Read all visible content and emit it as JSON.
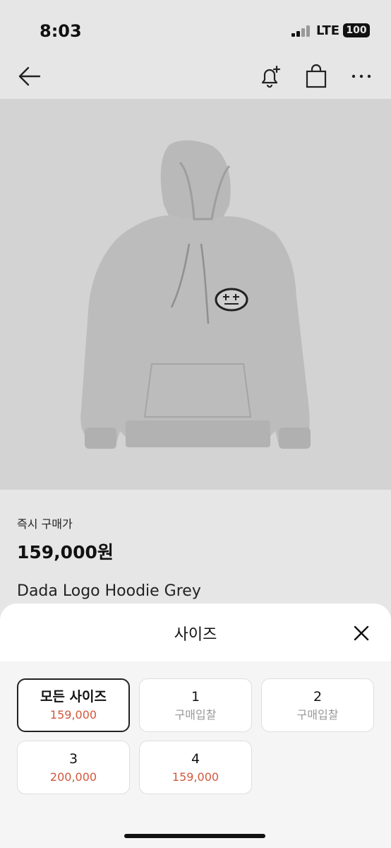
{
  "status": {
    "time": "8:03",
    "network": "LTE",
    "battery": "100"
  },
  "nav": {
    "back_icon": "arrow-left-icon",
    "bell_icon": "bell-plus-icon",
    "bag_icon": "shopping-bag-icon",
    "more_icon": "more-horizontal-icon"
  },
  "product": {
    "price_label": "즉시 구매가",
    "price": "159,000원",
    "name": "Dada Logo Hoodie Grey"
  },
  "size_sheet": {
    "title": "사이즈",
    "options": [
      {
        "label": "모든 사이즈",
        "sub": "159,000",
        "selected": true
      },
      {
        "label": "1",
        "sub": "구매입찰"
      },
      {
        "label": "2",
        "sub": "구매입찰"
      },
      {
        "label": "3",
        "sub": "200,000"
      },
      {
        "label": "4",
        "sub": "159,000"
      }
    ]
  },
  "colors": {
    "price_accent": "#d2583d",
    "hoodie": "#b7b7b7",
    "background": "#d3d3d3"
  }
}
